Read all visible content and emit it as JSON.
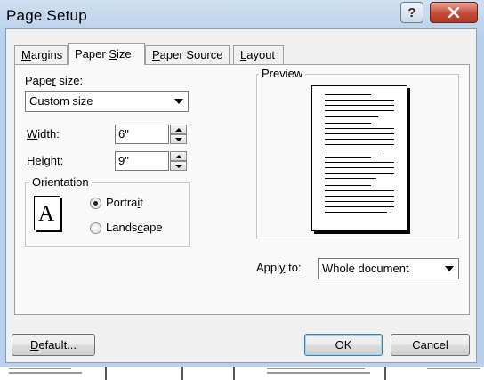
{
  "window": {
    "title": "Page Setup"
  },
  "titlebar": {
    "help_glyph": "?",
    "close_glyph": "✕"
  },
  "tabs": [
    {
      "label_pre": "",
      "label_key": "M",
      "label_post": "argins",
      "active": false
    },
    {
      "label_pre": "Paper ",
      "label_key": "S",
      "label_post": "ize",
      "active": true
    },
    {
      "label_pre": "",
      "label_key": "P",
      "label_post": "aper Source",
      "active": false
    },
    {
      "label_pre": "",
      "label_key": "L",
      "label_post": "ayout",
      "active": false
    }
  ],
  "paper_size": {
    "label_pre": "Pape",
    "label_key": "r",
    "label_post": " size:",
    "value": "Custom size"
  },
  "width": {
    "label_pre": "",
    "label_key": "W",
    "label_post": "idth:",
    "value": "6\""
  },
  "height": {
    "label_pre": "H",
    "label_key": "e",
    "label_post": "ight:",
    "value": "9\""
  },
  "orientation": {
    "legend": "Orientation",
    "icon_letter": "A",
    "portrait": {
      "label_pre": "Portra",
      "label_key": "i",
      "label_post": "t",
      "selected": true
    },
    "landscape": {
      "label_pre": "Lands",
      "label_key": "c",
      "label_post": "ape",
      "selected": false
    }
  },
  "preview": {
    "legend": "Preview"
  },
  "apply_to": {
    "label_pre": "Appl",
    "label_key": "y",
    "label_post": " to:",
    "value": "Whole document"
  },
  "buttons": {
    "default": {
      "label_pre": "",
      "label_key": "D",
      "label_post": "efault..."
    },
    "ok": "OK",
    "cancel": "Cancel"
  }
}
